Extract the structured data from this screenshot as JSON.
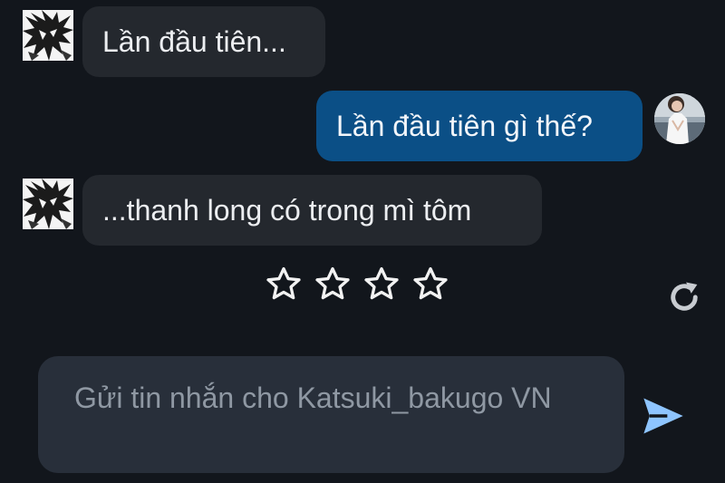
{
  "messages": [
    {
      "sender": "bot",
      "text": "Lần đầu tiên..."
    },
    {
      "sender": "user",
      "text": "Lần đầu tiên gì thế?"
    },
    {
      "sender": "bot",
      "text": "...thanh long có trong mì tôm"
    }
  ],
  "rating": {
    "stars_total": 4,
    "stars_filled": 0
  },
  "composer": {
    "placeholder": "Gửi tin nhắn cho Katsuki_bakugo VN"
  },
  "icons": {
    "bot_avatar": "manga-avatar-icon",
    "user_avatar": "user-avatar-icon",
    "rating": "star-outline-icon",
    "regenerate": "refresh-icon",
    "send": "send-icon"
  },
  "colors": {
    "background": "#12161c",
    "bot_bubble": "#24282e",
    "user_bubble": "#0b4f86",
    "input": "#282f3a",
    "send_accent": "#8ec5ff"
  }
}
